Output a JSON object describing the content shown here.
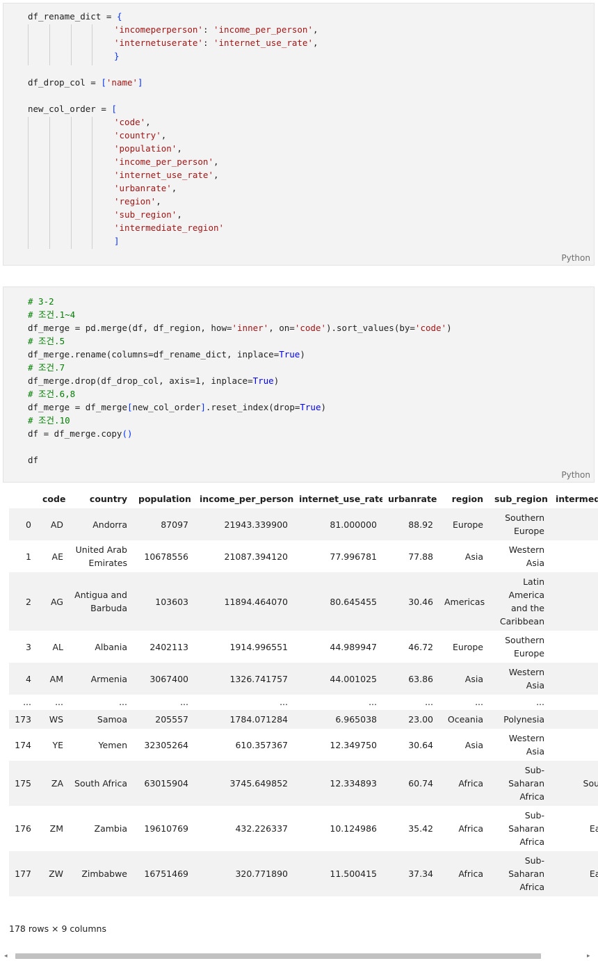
{
  "cells": [
    {
      "language": "Python",
      "lines": [
        [
          [
            "df_rename_dict = ",
            ""
          ],
          [
            "{",
            "br"
          ]
        ],
        [
          [
            "'incomeperperson'",
            "str"
          ],
          [
            ": ",
            ""
          ],
          [
            "'income_per_person'",
            "str"
          ],
          [
            ",",
            ""
          ]
        ],
        [
          [
            "'internetuserate'",
            "str"
          ],
          [
            ": ",
            ""
          ],
          [
            "'internet_use_rate'",
            "str"
          ],
          [
            ",",
            ""
          ]
        ],
        [
          [
            "}",
            "br"
          ]
        ],
        [],
        [
          [
            "df_drop_col = ",
            ""
          ],
          [
            "[",
            "br"
          ],
          [
            "'name'",
            "str"
          ],
          [
            "]",
            "br"
          ]
        ],
        [],
        [
          [
            "new_col_order = ",
            ""
          ],
          [
            "[",
            "br"
          ]
        ],
        [
          [
            "'code'",
            "str"
          ],
          [
            ",",
            ""
          ]
        ],
        [
          [
            "'country'",
            "str"
          ],
          [
            ",",
            ""
          ]
        ],
        [
          [
            "'population'",
            "str"
          ],
          [
            ",",
            ""
          ]
        ],
        [
          [
            "'income_per_person'",
            "str"
          ],
          [
            ",",
            ""
          ]
        ],
        [
          [
            "'internet_use_rate'",
            "str"
          ],
          [
            ",",
            ""
          ]
        ],
        [
          [
            "'urbanrate'",
            "str"
          ],
          [
            ",",
            ""
          ]
        ],
        [
          [
            "'region'",
            "str"
          ],
          [
            ",",
            ""
          ]
        ],
        [
          [
            "'sub_region'",
            "str"
          ],
          [
            ",",
            ""
          ]
        ],
        [
          [
            "'intermediate_region'",
            "str"
          ]
        ],
        [
          [
            "]",
            "br"
          ]
        ]
      ]
    },
    {
      "language": "Python",
      "lines": [
        [
          [
            "# 3-2",
            "cmt"
          ]
        ],
        [
          [
            "# 조건.1~4",
            "cmt"
          ]
        ],
        [
          [
            "df_merge = pd.merge(df, df_region, how=",
            ""
          ],
          [
            "'inner'",
            "str"
          ],
          [
            ", on=",
            ""
          ],
          [
            "'code'",
            "str"
          ],
          [
            ").sort_values(by=",
            ""
          ],
          [
            "'code'",
            "str"
          ],
          [
            ")",
            ""
          ]
        ],
        [
          [
            "# 조건.5",
            "cmt"
          ]
        ],
        [
          [
            "df_merge.rename(columns=df_rename_dict, inplace=",
            ""
          ],
          [
            "True",
            "kw"
          ],
          [
            ")",
            ""
          ]
        ],
        [
          [
            "# 조건.7",
            "cmt"
          ]
        ],
        [
          [
            "df_merge.drop(df_drop_col, axis=1, inplace=",
            ""
          ],
          [
            "True",
            "kw"
          ],
          [
            ")",
            ""
          ]
        ],
        [
          [
            "# 조건.6,8",
            "cmt"
          ]
        ],
        [
          [
            "df_merge = df_merge",
            ""
          ],
          [
            "[",
            "br"
          ],
          [
            "new_col_order",
            ""
          ],
          [
            "]",
            "br"
          ],
          [
            ".reset_index(drop=",
            ""
          ],
          [
            "True",
            "kw"
          ],
          [
            ")",
            ""
          ]
        ],
        [
          [
            "# 조건.10",
            "cmt"
          ]
        ],
        [
          [
            "df = df_merge.copy",
            ""
          ],
          [
            "()",
            "br"
          ]
        ],
        [],
        [
          [
            "df",
            ""
          ]
        ]
      ]
    }
  ],
  "table": {
    "columns": [
      "",
      "code",
      "country",
      "population",
      "income_per_person",
      "internet_use_rate",
      "urbanrate",
      "region",
      "sub_region",
      "intermediate_region"
    ],
    "rows": [
      [
        "0",
        "AD",
        "Andorra",
        "87097",
        "21943.339900",
        "81.000000",
        "88.92",
        "Europe",
        "Southern Europe",
        ""
      ],
      [
        "1",
        "AE",
        "United Arab Emirates",
        "10678556",
        "21087.394120",
        "77.996781",
        "77.88",
        "Asia",
        "Western Asia",
        ""
      ],
      [
        "2",
        "AG",
        "Antigua and Barbuda",
        "103603",
        "11894.464070",
        "80.645455",
        "30.46",
        "Americas",
        "Latin America and the Caribbean",
        ""
      ],
      [
        "3",
        "AL",
        "Albania",
        "2402113",
        "1914.996551",
        "44.989947",
        "46.72",
        "Europe",
        "Southern Europe",
        ""
      ],
      [
        "4",
        "AM",
        "Armenia",
        "3067400",
        "1326.741757",
        "44.001025",
        "63.86",
        "Asia",
        "Western Asia",
        ""
      ],
      [
        "...",
        "...",
        "...",
        "...",
        "...",
        "...",
        "...",
        "...",
        "...",
        "..."
      ],
      [
        "173",
        "WS",
        "Samoa",
        "205557",
        "1784.071284",
        "6.965038",
        "23.00",
        "Oceania",
        "Polynesia",
        ""
      ],
      [
        "174",
        "YE",
        "Yemen",
        "32305264",
        "610.357367",
        "12.349750",
        "30.64",
        "Asia",
        "Western Asia",
        ""
      ],
      [
        "175",
        "ZA",
        "South Africa",
        "63015904",
        "3745.649852",
        "12.334893",
        "60.74",
        "Africa",
        "Sub-Saharan Africa",
        "Southern Africa"
      ],
      [
        "176",
        "ZM",
        "Zambia",
        "19610769",
        "432.226337",
        "10.124986",
        "35.42",
        "Africa",
        "Sub-Saharan Africa",
        "Eastern Africa"
      ],
      [
        "177",
        "ZW",
        "Zimbabwe",
        "16751469",
        "320.771890",
        "11.500415",
        "37.34",
        "Africa",
        "Sub-Saharan Africa",
        "Eastern Africa"
      ]
    ],
    "summary": "178 rows × 9 columns"
  },
  "scrollbar": {
    "left_arrow": "◂",
    "right_arrow": "▸"
  }
}
